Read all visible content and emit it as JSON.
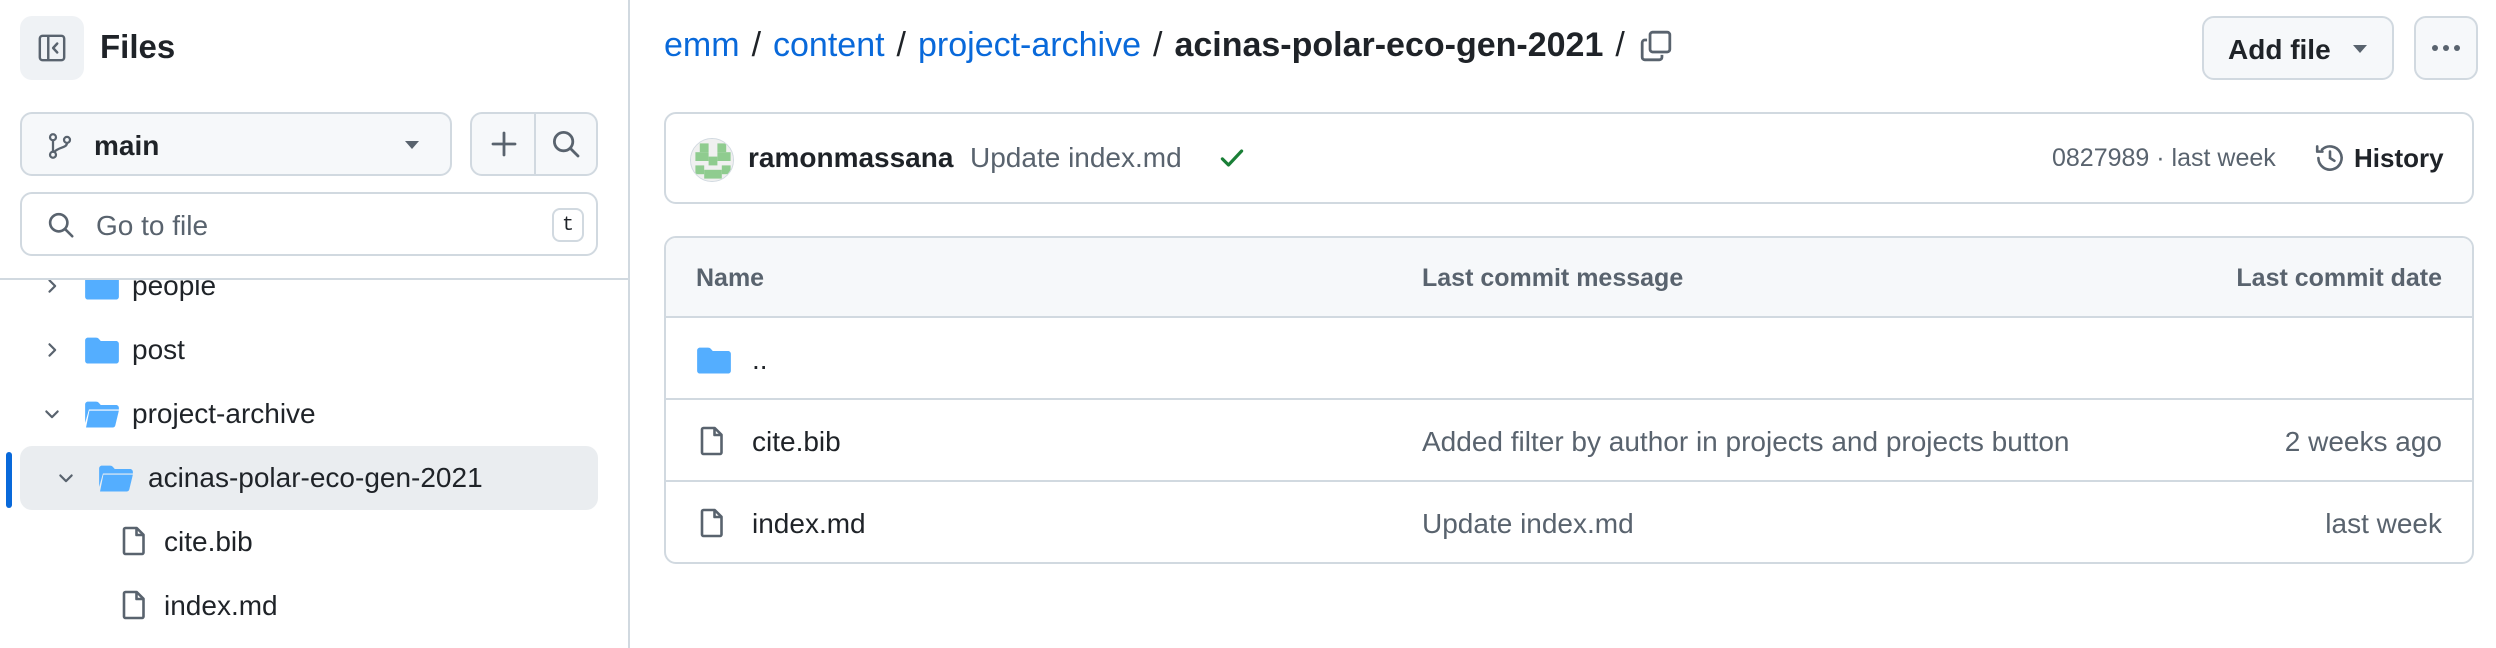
{
  "sidebar": {
    "title": "Files",
    "branch": "main",
    "search_placeholder": "Go to file",
    "search_shortcut": "t",
    "tree": [
      {
        "name": "people",
        "type": "folder",
        "expanded": false
      },
      {
        "name": "post",
        "type": "folder",
        "expanded": false
      },
      {
        "name": "project-archive",
        "type": "folder",
        "expanded": true
      },
      {
        "name": "acinas-polar-eco-gen-2021",
        "type": "folder",
        "expanded": true,
        "selected": true
      },
      {
        "name": "cite.bib",
        "type": "file"
      },
      {
        "name": "index.md",
        "type": "file"
      }
    ]
  },
  "breadcrumb": {
    "parts": [
      "emm",
      "content",
      "project-archive"
    ],
    "separator": "/",
    "current": "acinas-polar-eco-gen-2021",
    "trailing": "/"
  },
  "actions": {
    "add_file": "Add file"
  },
  "commit": {
    "author": "ramonmassana",
    "message": "Update index.md",
    "hash_time": "0827989 · last week",
    "history": "History"
  },
  "table": {
    "headers": [
      "Name",
      "Last commit message",
      "Last commit date"
    ],
    "parent_dir": "..",
    "rows": [
      {
        "name": "cite.bib",
        "message": "Added filter by author in projects and projects button",
        "date": "2 weeks ago"
      },
      {
        "name": "index.md",
        "message": "Update index.md",
        "date": "last week"
      }
    ]
  },
  "colors": {
    "link": "#0969da",
    "folder": "#54aeff",
    "success": "#1a7f37",
    "border": "#d1d9e0",
    "selected_bar": "#0969da"
  }
}
